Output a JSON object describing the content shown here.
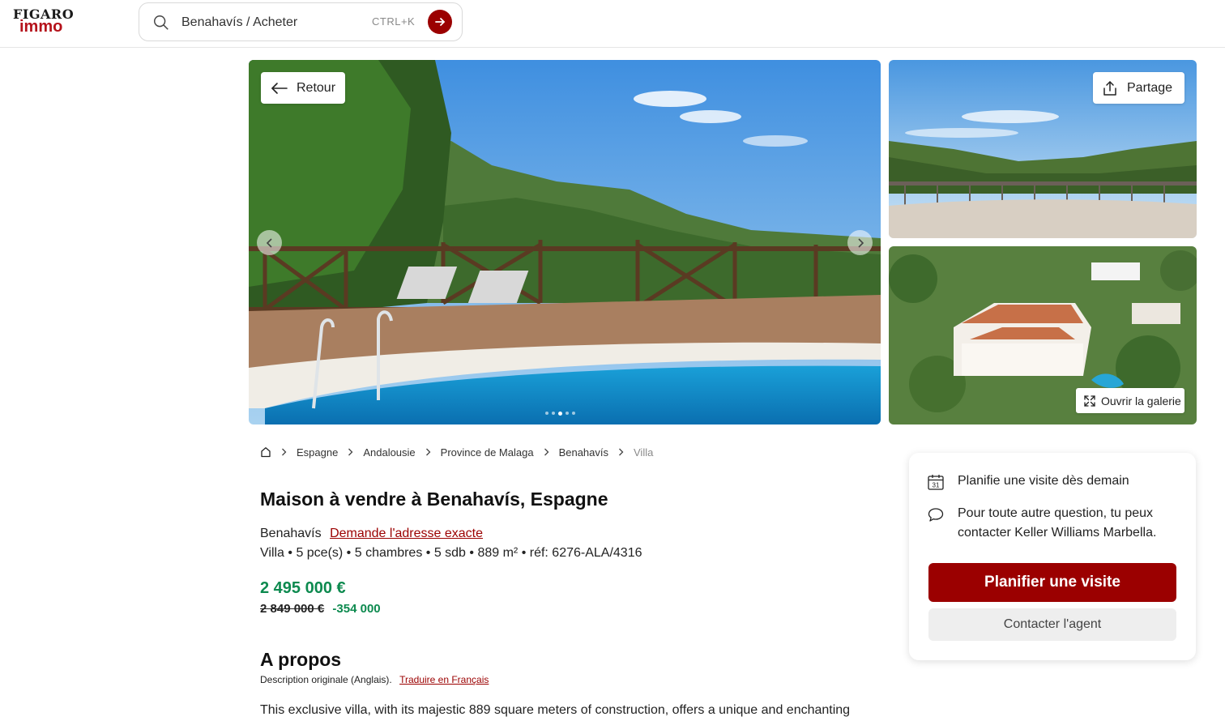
{
  "header": {
    "logo_top": "FIGARO",
    "logo_bottom": "immo",
    "search_value": "Benahavís / Acheter",
    "search_shortcut": "CTRL+K"
  },
  "gallery": {
    "back_label": "Retour",
    "share_label": "Partage",
    "open_gallery_label": "Ouvrir la galerie",
    "dots_count": 5,
    "active_dot": 3
  },
  "breadcrumb": {
    "items": [
      "Espagne",
      "Andalousie",
      "Province de Malaga",
      "Benahavís",
      "Villa"
    ]
  },
  "listing": {
    "title": "Maison à vendre à Benahavís, Espagne",
    "city": "Benahavís",
    "address_link": "Demande l'adresse exacte",
    "specs": "Villa • 5 pce(s) • 5 chambres • 5 sdb • 889 m² • réf: 6276-ALA/4316",
    "price": "2 495 000 €",
    "old_price": "2 849 000 €",
    "price_drop": "-354 000"
  },
  "about": {
    "title": "A propos",
    "original_desc": "Description originale (Anglais).",
    "translate_link": "Traduire en Français",
    "text": "This exclusive villa, with its majestic 889 square meters of construction, offers a unique and enchanting"
  },
  "contact": {
    "visit_info": "Planifie une visite dès demain",
    "question_info": "Pour toute autre question, tu peux contacter Keller Williams Marbella.",
    "schedule_button": "Planifier une visite",
    "agent_button": "Contacter l'agent",
    "calendar_day": "31"
  },
  "colors": {
    "brand_red": "#9b0000",
    "price_green": "#0d8a4f"
  }
}
